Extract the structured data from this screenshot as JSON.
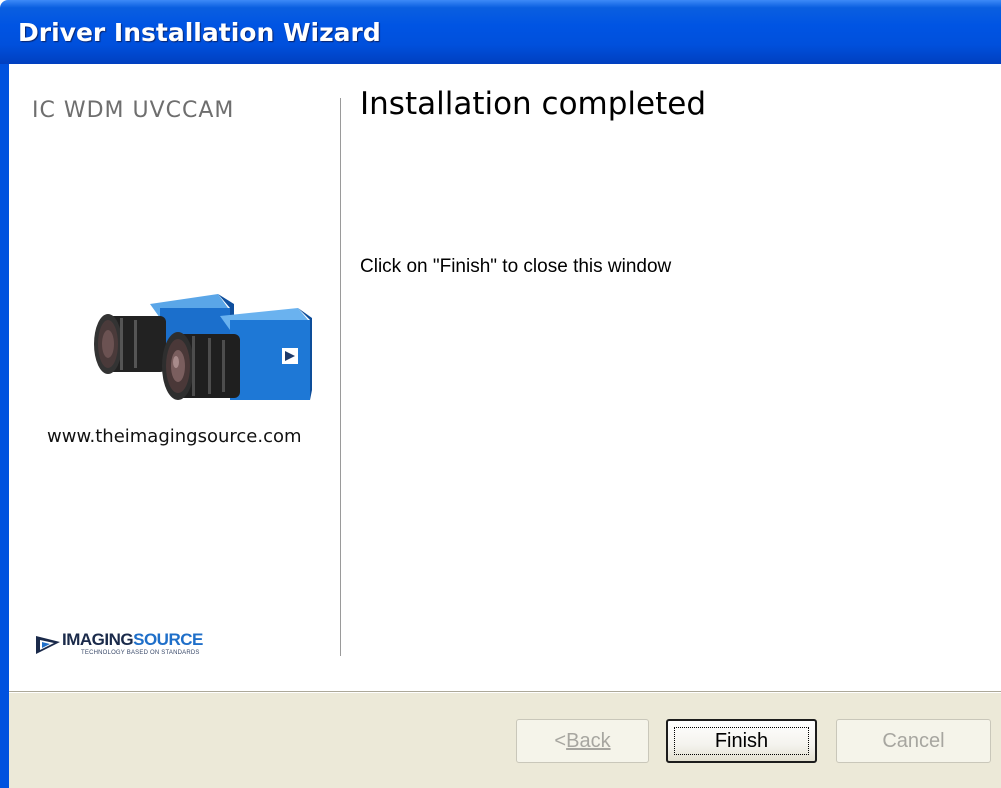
{
  "window": {
    "title": "Driver Installation Wizard",
    "accent_color": "#0054e3"
  },
  "sidebar": {
    "product_name": "IC WDM UVCCAM",
    "website": "www.theimagingsource.com",
    "image": "camera-product-image",
    "logo": {
      "name": "the-imaging-source-logo",
      "word_dark": "IMAGING",
      "word_blue": "SOURCE",
      "tagline": "TECHNOLOGY BASED ON STANDARDS"
    }
  },
  "main": {
    "heading": "Installation completed",
    "message": "Click on \"Finish\" to close this window"
  },
  "buttons": {
    "back_prefix": "< ",
    "back_label": "Back",
    "finish_label": "Finish",
    "cancel_label": "Cancel"
  }
}
